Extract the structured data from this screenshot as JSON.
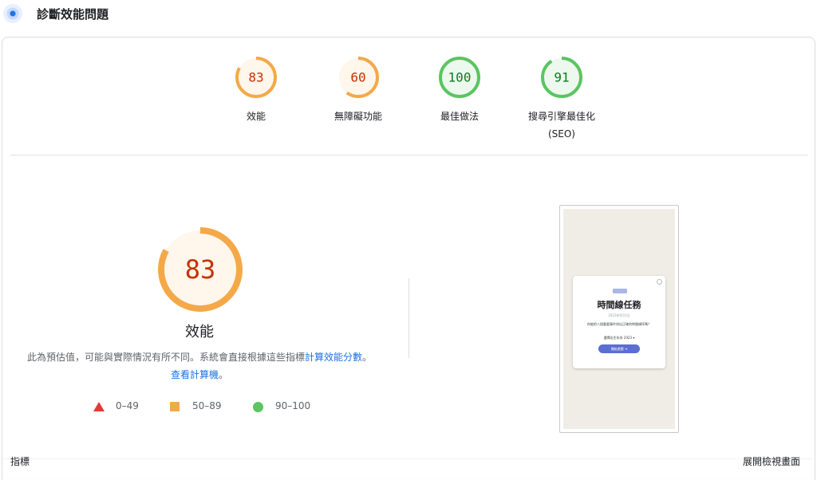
{
  "header": {
    "title": "診斷效能問題",
    "logo_icon": "lighthouse-logo-icon"
  },
  "colors": {
    "average": "#f4a949",
    "average_text": "#c33300",
    "average_fill": "#fff6ec",
    "pass": "#5ac561",
    "pass_text": "#0b7c1f",
    "pass_fill": "#edf8ee",
    "fail": "#e53935",
    "link": "#1a73e8"
  },
  "gauges": [
    {
      "score": "83",
      "label": "效能",
      "sublabel": "",
      "status": "average",
      "fraction": 0.83
    },
    {
      "score": "60",
      "label": "無障礙功能",
      "sublabel": "",
      "status": "average",
      "fraction": 0.6
    },
    {
      "score": "100",
      "label": "最佳做法",
      "sublabel": "",
      "status": "pass",
      "fraction": 1.0
    },
    {
      "score": "91",
      "label": "搜尋引擎最佳化",
      "sublabel": "(SEO)",
      "status": "pass",
      "fraction": 0.91
    }
  ],
  "performance": {
    "score": "83",
    "fraction": 0.83,
    "title": "效能",
    "description_prefix": "此為預估值，可能與實際情況有所不同。系統會直接根據這些指標",
    "link_calc": "計算效能分數",
    "description_mid": "。",
    "link_calculator": "查看計算機",
    "description_suffix": "。"
  },
  "legend": [
    {
      "range": "0–49",
      "icon": "triangle-icon"
    },
    {
      "range": "50–89",
      "icon": "square-icon"
    },
    {
      "range": "90–100",
      "icon": "circle-icon"
    }
  ],
  "screenshot": {
    "chip": "",
    "title": "時間線任務",
    "date": "2023年9月1日",
    "question": "你能把八個重要事件排出正確的時間順序嗎？",
    "select_label": "選擇出生年份 2023 ▾",
    "button_label": "開始遊戲 ➔"
  },
  "footer": {
    "metrics_label": "指標",
    "expand_label": "展開檢視畫面"
  }
}
